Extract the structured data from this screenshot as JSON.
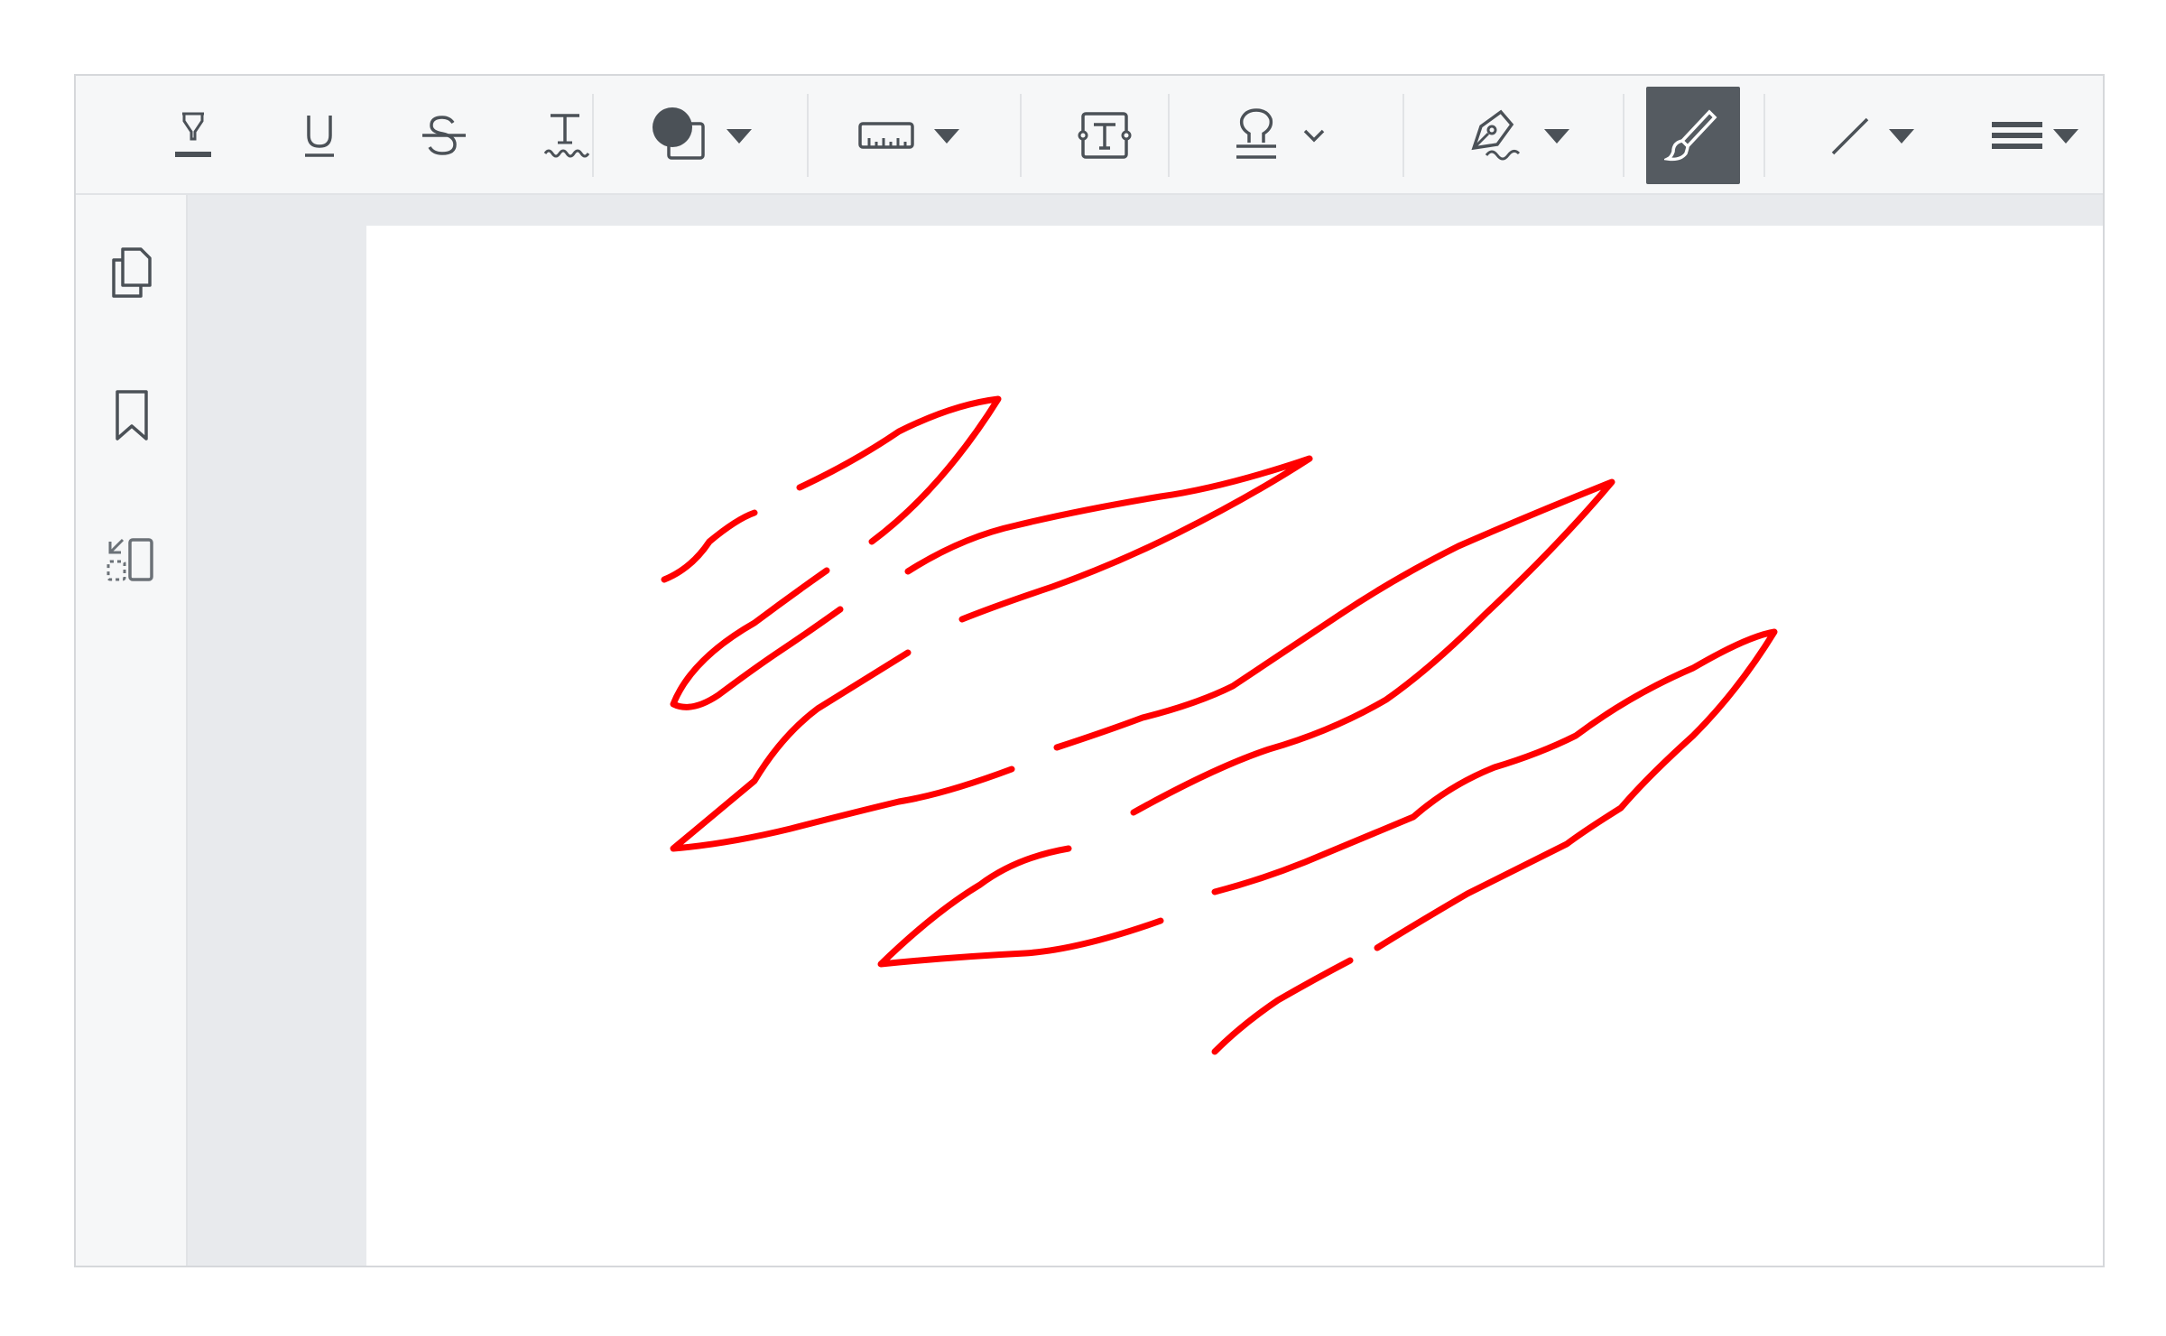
{
  "toolbar": {
    "items": [
      {
        "icon": "highlight-icon"
      },
      {
        "icon": "underline-icon"
      },
      {
        "icon": "strikethrough-icon"
      },
      {
        "icon": "squiggly-icon"
      },
      {
        "icon": "shape-icon",
        "dropdown": "chevron-down-icon"
      },
      {
        "icon": "measure-icon",
        "dropdown": "chevron-down-icon"
      },
      {
        "icon": "textbox-icon"
      },
      {
        "icon": "stamp-icon",
        "dropdown": "chevron-down-icon"
      },
      {
        "icon": "signature-icon",
        "dropdown": "chevron-down-icon"
      },
      {
        "icon": "freehand-icon",
        "active": true
      },
      {
        "icon": "line-icon",
        "dropdown": "chevron-down-icon"
      },
      {
        "icon": "line-weight-icon",
        "dropdown": "chevron-down-icon"
      }
    ]
  },
  "sidebar": {
    "items": [
      {
        "icon": "pages-icon"
      },
      {
        "icon": "bookmark-icon"
      },
      {
        "icon": "outline-icon"
      }
    ]
  },
  "colors": {
    "ink": "#ff0000",
    "active_tool_bg": "#555b61",
    "icon": "#4b5157"
  },
  "annotation": {
    "type": "freehand-ink",
    "color": "#ff0000"
  }
}
